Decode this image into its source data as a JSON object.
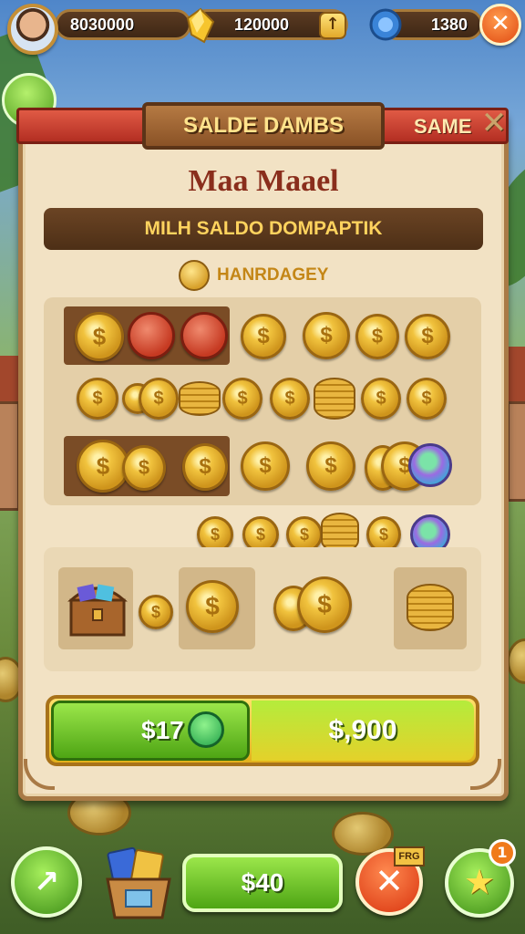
{
  "top_bar": {
    "coins_value": "8030000",
    "gems_value": "120000",
    "plus_label": "↑",
    "tokens_value": "1380",
    "close_label": "✕"
  },
  "panel": {
    "title": "SALDE DAMBS",
    "same_label": "SAME",
    "close_label": "✕",
    "heading": "Maa Maael",
    "subheading": "MILH SALDO DOMPAPTIK",
    "section_label": "HANRDAGEY"
  },
  "price_bar": {
    "left_price": "$17",
    "right_price": "$,900"
  },
  "bottom_bar": {
    "home_icon": "↗",
    "price_button": "$40",
    "close_label": "✕",
    "tag_label": "FRG",
    "star_label": "★",
    "badge_count": "1"
  },
  "colors": {
    "panel_bg": "#f2e2c4",
    "ribbon_red": "#c8392a",
    "gold": "#e9b640",
    "green_button": "#4ea514"
  }
}
